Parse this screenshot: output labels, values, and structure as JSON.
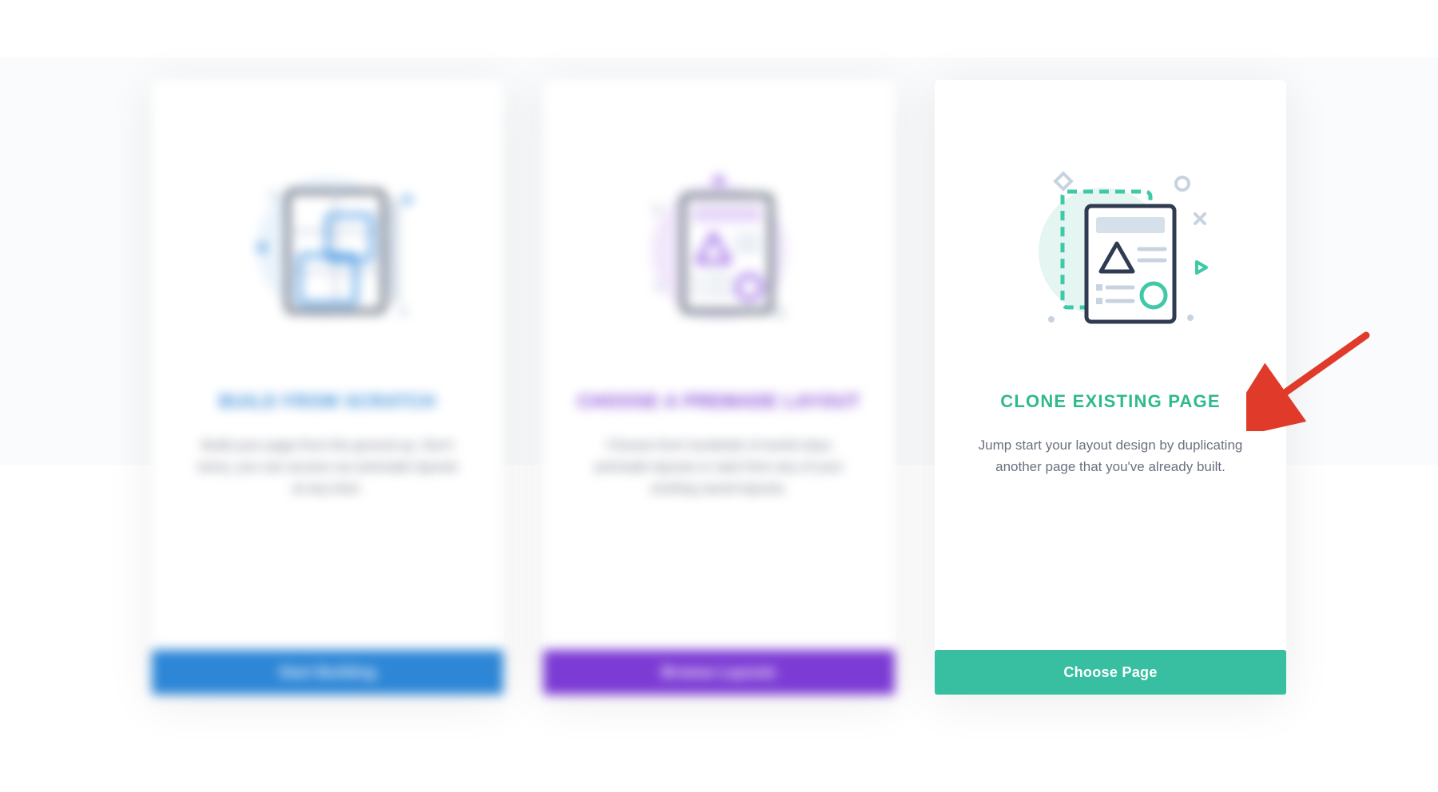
{
  "cards": [
    {
      "title": "BUILD FROM SCRATCH",
      "desc": "Build your page from the ground up. Don't worry, you can access our premade layouts at any time.",
      "button": "Start Building"
    },
    {
      "title": "CHOOSE A PREMADE LAYOUT",
      "desc": "Choose from hundreds of world-class premade layouts or start from any of your existing saved layouts.",
      "button": "Browse Layouts"
    },
    {
      "title": "CLONE EXISTING PAGE",
      "desc": "Jump start your layout design by duplicating another page that you've already built.",
      "button": "Choose Page"
    }
  ],
  "colors": {
    "blue": "#2d86d6",
    "purple": "#7c3bd4",
    "teal": "#2fb98f",
    "tealBtn": "#38bfa1",
    "arrow": "#e03b2a"
  }
}
